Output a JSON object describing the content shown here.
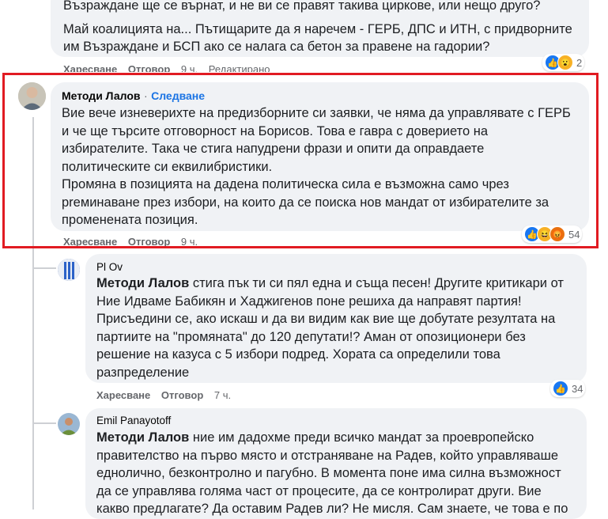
{
  "prev_comment": {
    "lines": [
      "Възраждане ще се върнат, и не ви се правят такива циркове, или нещо друго?",
      "Май коалицията на... Пътищарите да я наречем - ГЕРБ, ДПС и ИТН, с придворните",
      "им Възраждане и БСП ако се налага са бетон за правене на гадории?"
    ],
    "like": "Харесване",
    "reply": "Отговор",
    "time": "9 ч.",
    "edited": "Редактирано",
    "reaction_count": "2"
  },
  "main_comment": {
    "author": "Методи Лалов",
    "follow": "Следване",
    "text": "Вие вече изневерихте на предизборните си заявки, че няма да управлявате с ГЕРБ\nи че ще търсите отговорност на Борисов. Това е гавра с доверието на\nизбирателите. Така че стига напудрени фрази и опити да оправдаете\nполитическите си еквилибристики.\nПромяна в позицията на дадена политическа сила е възможна само чрез\npreминаване през избори, на които да се поиска нов мандат от избирателите за\nпромененaта позиция.",
    "like": "Харесване",
    "reply": "Отговор",
    "time": "9 ч.",
    "reaction_count": "54"
  },
  "reply1": {
    "author": "Pl Ov",
    "mention": "Методи Лалов",
    "text": " стига пък ти си пял една и съща песен! Другите критикари от\nНие Идваме Бабикян и Хаджигенов поне решиха да направят партия!\nПрисъедини се, ако искаш и да ви видим как вие ще добутате резултата на\nпартиите на \"промяната\" до 120 депутати!? Аман от опозиционери без\nрешение на казуса с 5 избори подред. Хората са определили това\nразпределение",
    "like": "Харесване",
    "reply": "Отговор",
    "time": "7 ч.",
    "reaction_count": "34"
  },
  "reply2": {
    "author": "Emil Panayotoff",
    "mention": "Методи Лалов",
    "text": " ние им дадохме преди всичко мандат за проевропейско\nправителство на първо място и отстраняване на Радев, който управляваше\nеднолично, безконтролно и пагубно. В момента поне има силна възможност\nда се управлява голяма част от процесите, да се контролират други. Вие\nкакво предлагате? Да оставим Радев ли? Не мисля. Сам знаете, че това е по"
  }
}
